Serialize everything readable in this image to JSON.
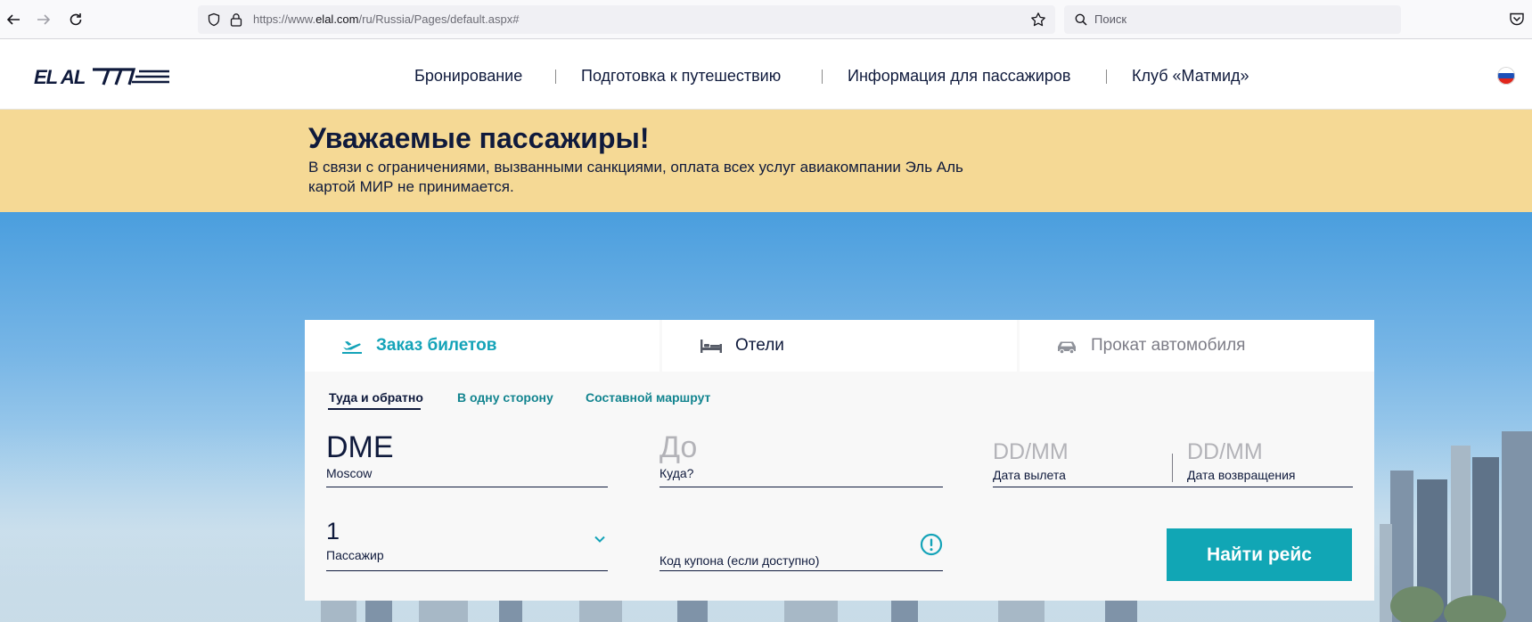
{
  "browser": {
    "url_prefix": "https://www.",
    "url_domain": "elal.com",
    "url_path": "/ru/Russia/Pages/default.aspx#",
    "search_placeholder": "Поиск"
  },
  "header": {
    "logo_text": "EL AL",
    "menu": [
      {
        "label": "Бронирование"
      },
      {
        "label": "Подготовка к путешествию"
      },
      {
        "label": "Информация для пассажиров"
      },
      {
        "label": "Клуб «Матмид»"
      }
    ],
    "language_flag": "russia-flag-icon"
  },
  "notice": {
    "title": "Уважаемые пассажиры!",
    "text": "В связи с ограничениями, вызванными санкциями, оплата всех услуг авиакомпании Эль Аль картой МИР не принимается."
  },
  "booking": {
    "tabs": [
      {
        "label": "Заказ билетов",
        "icon": "plane-departure-icon",
        "active": true
      },
      {
        "label": "Отели",
        "icon": "bed-icon",
        "active": false
      },
      {
        "label": "Прокат автомобиля",
        "icon": "car-icon",
        "active": false
      }
    ],
    "trip_types": [
      {
        "label": "Туда и обратно",
        "active": true
      },
      {
        "label": "В одну сторону",
        "active": false
      },
      {
        "label": "Составной маршрут",
        "active": false
      }
    ],
    "origin": {
      "code": "DME",
      "city": "Moscow"
    },
    "destination": {
      "placeholder": "До",
      "label": "Куда?"
    },
    "depart_date": {
      "placeholder": "DD/MM",
      "label": "Дата вылета"
    },
    "return_date": {
      "placeholder": "DD/MM",
      "label": "Дата возвращения"
    },
    "passengers": {
      "value": "1",
      "label": "Пассажир"
    },
    "coupon": {
      "label": "Код купона (если доступно)"
    },
    "search_button": "Найти рейс",
    "accent_color": "#11a6b5"
  }
}
